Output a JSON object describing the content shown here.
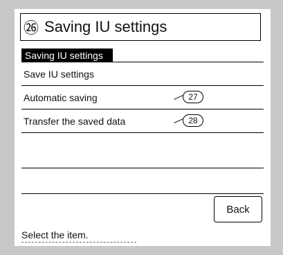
{
  "header": {
    "number": "㉖",
    "title": "Saving IU settings"
  },
  "screen": {
    "tab_label": "Saving IU settings"
  },
  "menu": {
    "items": [
      {
        "label": "Save IU settings",
        "callout": ""
      },
      {
        "label": "Automatic saving",
        "callout": "27"
      },
      {
        "label": "Transfer the saved data",
        "callout": "28"
      },
      {
        "label": "",
        "callout": ""
      },
      {
        "label": "",
        "callout": ""
      }
    ]
  },
  "footer": {
    "back_label": "Back",
    "status_text": "Select the item."
  }
}
